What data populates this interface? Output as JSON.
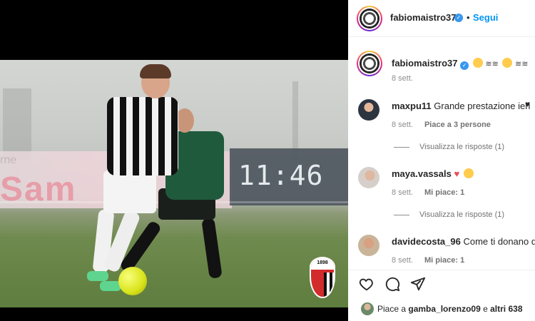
{
  "photo": {
    "board_text_top": "rne",
    "board_text_big": "Sam",
    "clock": "11:46",
    "crest_year": "1898"
  },
  "header": {
    "username": "fabiomaistro37",
    "follow_label": "Segui",
    "separator": "•"
  },
  "caption": {
    "username": "fabiomaistro37",
    "time": "8 sett."
  },
  "comments": [
    {
      "username": "maxpu11",
      "text": "Grande prestazione ieri",
      "time": "8 sett.",
      "likes": "Piace a 3 persone",
      "replies": "Visualizza le risposte (1)"
    },
    {
      "username": "maya.vassals",
      "text": "",
      "time": "8 sett.",
      "likes": "Mi piace: 1",
      "replies": "Visualizza le risposte (1)"
    },
    {
      "username": "davidecosta_96",
      "text": "Come ti donano que",
      "time": "8 sett.",
      "likes": "Mi piace: 1"
    }
  ],
  "likes_summary": {
    "prefix": "Piace a",
    "user": "gamba_lorenzo09",
    "suffix": "e",
    "others": "altri 638"
  },
  "icons": {
    "heart": "heart-icon",
    "comment": "comment-icon",
    "share": "share-icon"
  },
  "colors": {
    "accent": "#0095f6",
    "verified": "#3897f0",
    "red_heart": "#ed4956"
  }
}
